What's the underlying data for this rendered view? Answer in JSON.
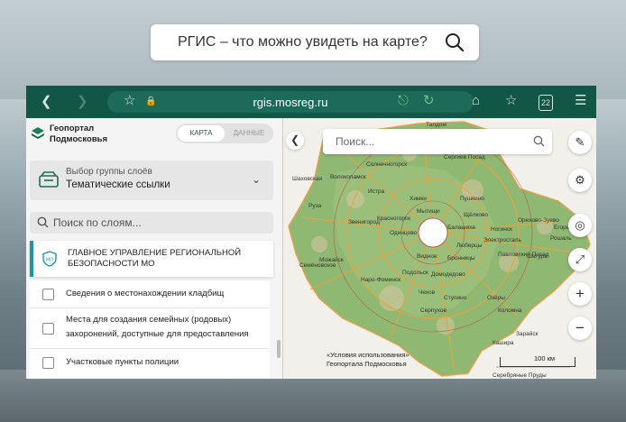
{
  "search": {
    "query": "РГИС – что можно увидеть на карте?"
  },
  "browser": {
    "url": "rgis.mosreg.ru",
    "tab_count": "22"
  },
  "sidebar": {
    "logo_text_1": "Геопортал",
    "logo_text_2": "Подмосковья",
    "toggle": {
      "active": "КАРТА",
      "inactive": "ДАННЫЕ"
    },
    "group": {
      "label": "Выбор группы слоёв",
      "value": "Тематические ссылки"
    },
    "layer_search_placeholder": "Поиск по слоям...",
    "org": {
      "line1": "ГЛАВНОЕ УПРАВЛЕНИЕ РЕГИОНАЛЬНОЙ",
      "line2": "БЕЗОПАСНОСТИ МО",
      "badge": "МО"
    },
    "layers": [
      {
        "line1": "Сведения о местонахождении кладбищ",
        "line2": ""
      },
      {
        "line1": "Места для создания семейных (родовых)",
        "line2": "захоронений, доступные для предоставления"
      },
      {
        "line1": "Участковые пункты полиции",
        "line2": ""
      }
    ]
  },
  "map": {
    "search_placeholder": "Поиск...",
    "terms_1": "«Условия использования»",
    "terms_2": "Геопортала Подмосковья",
    "scale": "100 км",
    "cities": [
      "Талдом",
      "Дубна",
      "Клин",
      "Дмитров",
      "Сергиев Посад",
      "Солнечногорск",
      "Шаховская",
      "Волоколамск",
      "Истра",
      "Химки",
      "Пушкино",
      "Мытищи",
      "Щёлково",
      "Красногорск",
      "Балашиха",
      "Рузa",
      "Звенигород",
      "Одинцово",
      "Орехово-Зуево",
      "Можайск",
      "Наро-Фоминск",
      "Подольск",
      "Люберцы",
      "Егорьевск",
      "Бронницы",
      "Коломна",
      "Серпухов",
      "Ступино",
      "Озёры",
      "Зарайск",
      "Кашира",
      "Серебряные Пруды",
      "Шатура",
      "Рошаль",
      "Электросталь",
      "Ногинск",
      "Семёновское",
      "Видное",
      "Домодедово",
      "Чехов",
      "Павловский Посад"
    ]
  },
  "colors": {
    "browser_bar": "#125646",
    "accent": "#1a9aa0"
  }
}
